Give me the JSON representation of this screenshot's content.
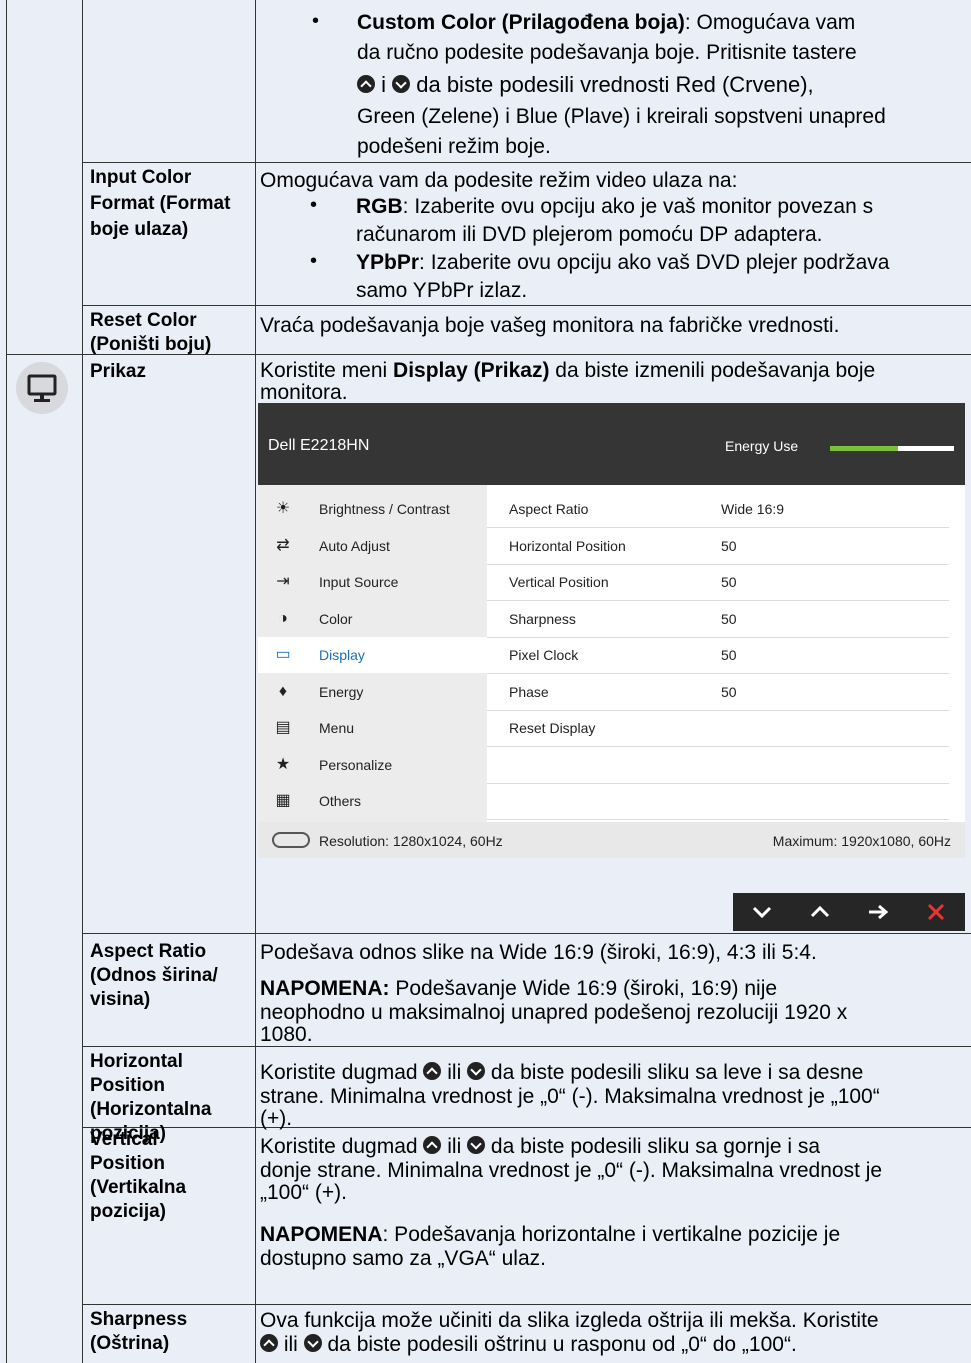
{
  "rows": {
    "custom_color": {
      "title": "Custom Color (Prilagođena boja)",
      "text_a": ": Omogućava vam",
      "line2": "da ručno podesite podešavanja boje. Pritisnite tastere",
      "line3_mid": " i ",
      "line3_end": " da biste podesili vrednosti Red (Crvene),",
      "line4": "Green (Zelene) i Blue (Plave) i kreirali sopstveni unapred",
      "line5": "podešeni režim boje."
    },
    "input_color": {
      "label1": "Input Color",
      "label2": "Format (Format",
      "label3": "boje ulaza)",
      "intro": "Omogućava vam da podesite režim video ulaza na:",
      "rgb_title": "RGB",
      "rgb_text1": ": Izaberite ovu opciju ako je vaš monitor povezan s",
      "rgb_text2": "računarom ili DVD plejerom pomoću DP adaptera.",
      "ypbpr_title": "YPbPr",
      "ypbpr_text1": ": Izaberite ovu opciju ako vaš DVD plejer podržava",
      "ypbpr_text2": "samo YPbPr izlaz."
    },
    "reset_color": {
      "label1": "Reset Color",
      "label2": "(Poništi boju)",
      "text": "Vraća podešavanja boje vašeg monitora na fabričke vrednosti."
    },
    "prikaz": {
      "label": "Prikaz",
      "text_pre": "Koristite meni ",
      "text_bold": "Display (Prikaz)",
      "text_post": " da biste izmenili podešavanja boje",
      "text_line2": "monitora."
    },
    "aspect": {
      "label1": "Aspect Ratio",
      "label2": "(Odnos širina/",
      "label3": "visina)",
      "text": "Podešava odnos slike na Wide 16:9 (široki, 16:9), 4:3 ili 5:4.",
      "note_bold": "NAPOMENA:",
      "note1": " Podešavanje Wide 16:9 (široki, 16:9) nije",
      "note2": "neophodno u maksimalnoj unapred podešenoj rezoluciji 1920 x",
      "note3": "1080."
    },
    "hpos": {
      "label1": "Horizontal",
      "label2": "Position",
      "label3": "(Horizontalna",
      "label4": "pozicija)",
      "l1_pre": "Koristite dugmad ",
      "l1_mid": " ili ",
      "l1_post": " da biste podesili sliku sa leve i sa desne",
      "l2": "strane. Minimalna vrednost je „0“ (-). Maksimalna vrednost je „100“",
      "l3": "(+)."
    },
    "vpos": {
      "label1": "Vertical",
      "label2": "Position",
      "label3": "(Vertikalna",
      "label4": "pozicija)",
      "l1_pre": " Koristite dugmad ",
      "l1_mid": " ili ",
      "l1_post": " da biste podesili sliku sa gornje i sa",
      "l2": "donje strane. Minimalna vrednost je „0“ (-). Maksimalna vrednost je",
      "l3": "„100“ (+).",
      "note_bold": "NAPOMENA",
      "note1": ": Podešavanja horizontalne i vertikalne pozicije je",
      "note2": "dostupno samo za „VGA“ ulaz."
    },
    "sharp": {
      "label1": "Sharpness",
      "label2": "(Oštrina)",
      "l1": "Ova funkcija može učiniti da slika izgleda oštrija ili mekša. Koristite",
      "l2_mid": " ili ",
      "l2_post": " da biste podesili oštrinu u rasponu od „0“ do „100“."
    }
  },
  "osd": {
    "title": "Dell E2218HN",
    "energy_label": "Energy Use",
    "energy_level": 0.55,
    "menu": [
      {
        "label": "Brightness / Contrast",
        "icon": "brightness-icon",
        "glyph": "☀"
      },
      {
        "label": "Auto Adjust",
        "icon": "auto-adjust-icon",
        "glyph": "⇄"
      },
      {
        "label": "Input Source",
        "icon": "input-source-icon",
        "glyph": "⇥"
      },
      {
        "label": "Color",
        "icon": "color-icon",
        "glyph": "◑"
      },
      {
        "label": "Display",
        "icon": "display-icon",
        "glyph": "▭"
      },
      {
        "label": "Energy",
        "icon": "energy-icon",
        "glyph": "♦"
      },
      {
        "label": "Menu",
        "icon": "menu-icon",
        "glyph": "▤"
      },
      {
        "label": "Personalize",
        "icon": "star-icon",
        "glyph": "★"
      },
      {
        "label": "Others",
        "icon": "others-icon",
        "glyph": "▦"
      }
    ],
    "active_index": 4,
    "settings": [
      {
        "key": "Aspect Ratio",
        "value": "Wide 16:9"
      },
      {
        "key": "Horizontal Position",
        "value": "50"
      },
      {
        "key": "Vertical Position",
        "value": "50"
      },
      {
        "key": "Sharpness",
        "value": "50"
      },
      {
        "key": "Pixel Clock",
        "value": "50"
      },
      {
        "key": "Phase",
        "value": "50"
      },
      {
        "key": "Reset Display",
        "value": ""
      }
    ],
    "resolution": "Resolution: 1280x1024, 60Hz",
    "maximum": "Maximum: 1920x1080, 60Hz"
  },
  "nav": {
    "down": "✓",
    "up": "^",
    "right": "→",
    "close": "✕"
  }
}
